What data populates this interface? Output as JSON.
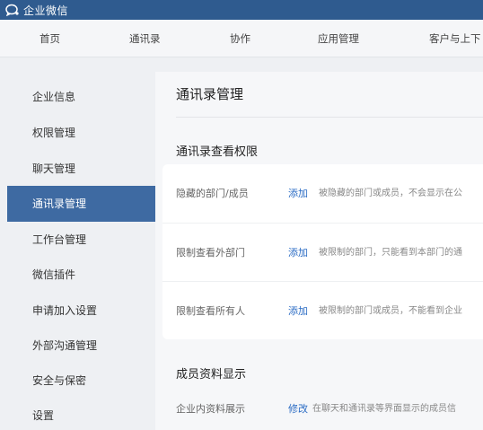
{
  "brand": {
    "name": "企业微信"
  },
  "nav": [
    {
      "label": "首页"
    },
    {
      "label": "通讯录"
    },
    {
      "label": "协作"
    },
    {
      "label": "应用管理"
    },
    {
      "label": "客户与上下"
    }
  ],
  "sidebar": {
    "active_index": 3,
    "items": [
      {
        "label": "企业信息"
      },
      {
        "label": "权限管理"
      },
      {
        "label": "聊天管理"
      },
      {
        "label": "通讯录管理"
      },
      {
        "label": "工作台管理"
      },
      {
        "label": "微信插件"
      },
      {
        "label": "申请加入设置"
      },
      {
        "label": "外部沟通管理"
      },
      {
        "label": "安全与保密"
      },
      {
        "label": "设置"
      }
    ]
  },
  "main": {
    "page_title": "通讯录管理",
    "view_permissions": {
      "title": "通讯录查看权限",
      "rows": [
        {
          "label": "隐藏的部门/成员",
          "action": "添加",
          "desc": "被隐藏的部门或成员，不会显示在公"
        },
        {
          "label": "限制查看外部门",
          "action": "添加",
          "desc": "被限制的部门，只能看到本部门的通"
        },
        {
          "label": "限制查看所有人",
          "action": "添加",
          "desc": "被限制的部门或成员，不能看到企业"
        }
      ]
    },
    "member_info": {
      "title": "成员资料显示",
      "rows": [
        {
          "label": "企业内资料展示",
          "action": "修改",
          "desc": "在聊天和通讯录等界面显示的成员信"
        }
      ]
    }
  },
  "colors": {
    "brand_bar": "#2f5b8f",
    "active_item": "#3e6aa2",
    "link": "#2b6cc4"
  }
}
